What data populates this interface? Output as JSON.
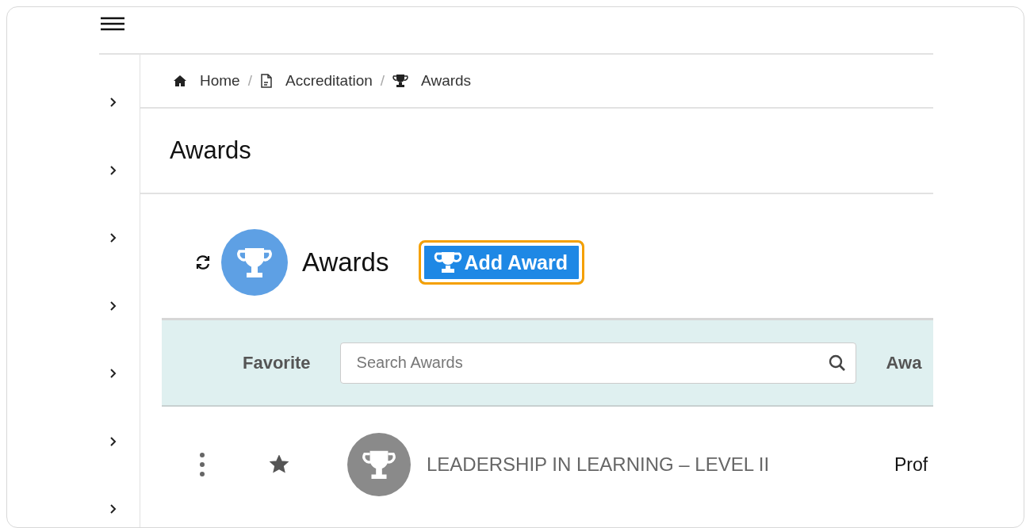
{
  "sidebar": {
    "items": [
      {
        "expanded": false
      },
      {
        "expanded": false
      },
      {
        "expanded": false
      },
      {
        "expanded": false
      },
      {
        "expanded": false
      },
      {
        "expanded": false
      },
      {
        "expanded": false
      }
    ]
  },
  "breadcrumb": [
    {
      "label": "Home",
      "kind": "home"
    },
    {
      "label": "/",
      "kind": "separator"
    },
    {
      "label": "Accreditation",
      "kind": "document"
    },
    {
      "label": "/",
      "kind": "separator"
    },
    {
      "label": "Awards",
      "kind": "trophy"
    }
  ],
  "page_title": "Awards",
  "section": {
    "title": "Awards",
    "add_button": "Add Award",
    "add_button_focused": true
  },
  "table": {
    "columns": [
      {
        "kind": "label",
        "label": "Favorite"
      },
      {
        "kind": "search",
        "placeholder": "Search Awards"
      },
      {
        "kind": "label",
        "label": "Awa"
      }
    ],
    "rows": [
      {
        "favorite": true,
        "name": "LEADERSHIP IN LEARNING – LEVEL II",
        "column_3": "Prof"
      }
    ]
  }
}
